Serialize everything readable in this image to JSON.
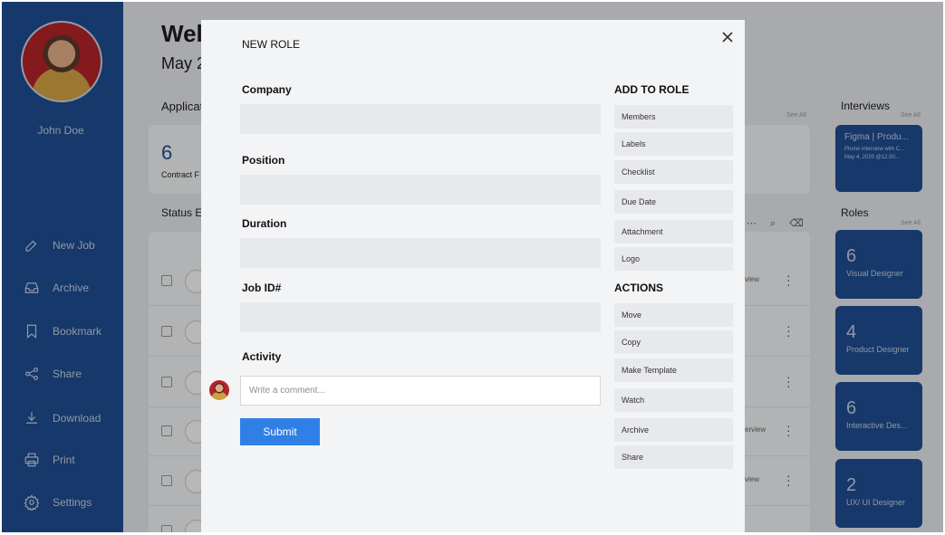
{
  "user": {
    "name": "John Doe"
  },
  "nav": [
    {
      "label": "New Job",
      "icon": "edit-icon"
    },
    {
      "label": "Archive",
      "icon": "inbox-icon"
    },
    {
      "label": "Bookmark",
      "icon": "bookmark-icon"
    },
    {
      "label": "Share",
      "icon": "share-icon"
    },
    {
      "label": "Download",
      "icon": "download-icon"
    },
    {
      "label": "Print",
      "icon": "printer-icon"
    },
    {
      "label": "Settings",
      "icon": "gear-icon"
    }
  ],
  "background": {
    "title": "Welc",
    "date": "May 2",
    "applications_label": "Applicat",
    "card_count": "6",
    "card_label": "Contract F",
    "status_label": "Status E",
    "see_all": "See All",
    "row_views": [
      "view",
      "",
      "",
      "erview",
      "view",
      ""
    ],
    "interviews": {
      "heading": "Interviews",
      "card_title": "Figma | Produ...",
      "card_sub1": "Phone interview with C...",
      "card_sub2": "May 4, 2020 @12:30..."
    },
    "roles": {
      "heading": "Roles",
      "items": [
        {
          "count": "6",
          "label": "Visual Designer"
        },
        {
          "count": "4",
          "label": "Product Designer"
        },
        {
          "count": "6",
          "label": "Interactive Des..."
        },
        {
          "count": "2",
          "label": "UX/ UI Designer"
        }
      ]
    }
  },
  "modal": {
    "title": "NEW ROLE",
    "fields": [
      {
        "label": "Company",
        "value": ""
      },
      {
        "label": "Position",
        "value": ""
      },
      {
        "label": "Duration",
        "value": ""
      },
      {
        "label": "Job ID#",
        "value": ""
      }
    ],
    "activity_label": "Activity",
    "comment_placeholder": "Write a comment...",
    "submit_label": "Submit",
    "add_to_role": {
      "heading": "ADD TO ROLE",
      "items": [
        "Members",
        "Labels",
        "Checklist",
        "Due Date",
        "Attachment",
        "Logo"
      ]
    },
    "actions": {
      "heading": "ACTIONS",
      "items": [
        "Move",
        "Copy",
        "Make Template",
        "Watch",
        "Archive",
        "Share"
      ]
    }
  },
  "colors": {
    "sidebar": "#1f4e93",
    "primary_button": "#2f7fe6",
    "modal_bg": "#f3f4f6"
  }
}
